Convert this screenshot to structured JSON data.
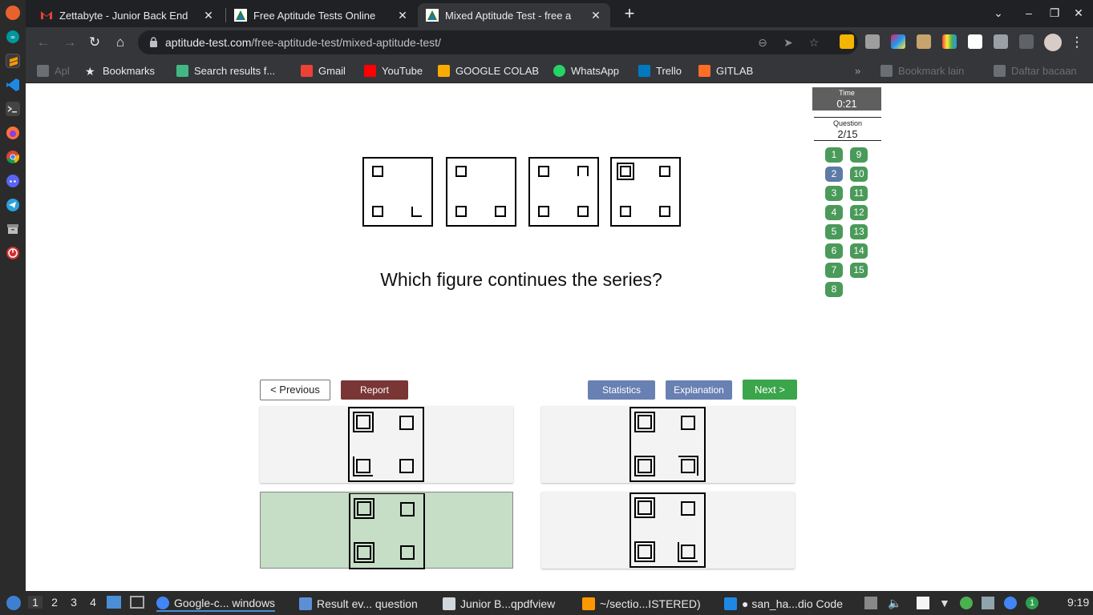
{
  "browser": {
    "tabs": [
      {
        "title": "Zettabyte - Junior Back End",
        "active": false
      },
      {
        "title": "Free Aptitude Tests Online",
        "active": false
      },
      {
        "title": "Mixed Aptitude Test - free a",
        "active": true
      }
    ],
    "url_host": "aptitude-test.com",
    "url_path": "/free-aptitude-test/mixed-aptitude-test/",
    "bookmarks": [
      {
        "label": "Apl",
        "icon": "apps-grid-icon"
      },
      {
        "label": "Bookmarks",
        "icon": "star-icon"
      },
      {
        "label": "Search results f...",
        "icon": "vue-icon"
      },
      {
        "label": "Gmail",
        "icon": "gmail-icon"
      },
      {
        "label": "YouTube",
        "icon": "youtube-icon"
      },
      {
        "label": "GOOGLE COLAB",
        "icon": "colab-icon"
      },
      {
        "label": "WhatsApp",
        "icon": "whatsapp-icon"
      },
      {
        "label": "Trello",
        "icon": "trello-icon"
      },
      {
        "label": "GITLAB",
        "icon": "gitlab-icon"
      }
    ],
    "bookmarks_overflow": "»",
    "other_bookmarks": "Bookmark lain",
    "reading_list": "Daftar bacaan"
  },
  "quiz": {
    "time_label": "Time",
    "time_value": "0:21",
    "question_label": "Question",
    "question_value": "2/15",
    "question_numbers": [
      "1",
      "2",
      "3",
      "4",
      "5",
      "6",
      "7",
      "8",
      "9",
      "10",
      "11",
      "12",
      "13",
      "14",
      "15"
    ],
    "current_question": "2",
    "question_text": "Which figure continues the series?",
    "buttons": {
      "previous": "<  Previous",
      "report": "Report",
      "statistics": "Statistics",
      "explanation": "Explanation",
      "next": "Next  >"
    },
    "selected_answer_index": 2,
    "colors": {
      "green": "#4a9a59",
      "current": "#5d7ba6",
      "report": "#7a3535",
      "blue_button": "#6980b3",
      "next": "#3aa54a",
      "selected": "#c6ddc6"
    }
  },
  "taskbar": {
    "workspaces": [
      "1",
      "2",
      "3",
      "4"
    ],
    "apps": [
      {
        "label": "Google-c... windows",
        "icon": "chrome-icon"
      },
      {
        "label": "Result ev... question",
        "icon": "folder-icon"
      },
      {
        "label": "Junior B...qpdfview",
        "icon": "pdf-icon"
      },
      {
        "label": "~/sectio...ISTERED)",
        "icon": "sublime-icon"
      },
      {
        "label": "● san_ha...dio Code",
        "icon": "vscode-icon"
      }
    ],
    "clock": "9:19",
    "notification_count": "1"
  }
}
